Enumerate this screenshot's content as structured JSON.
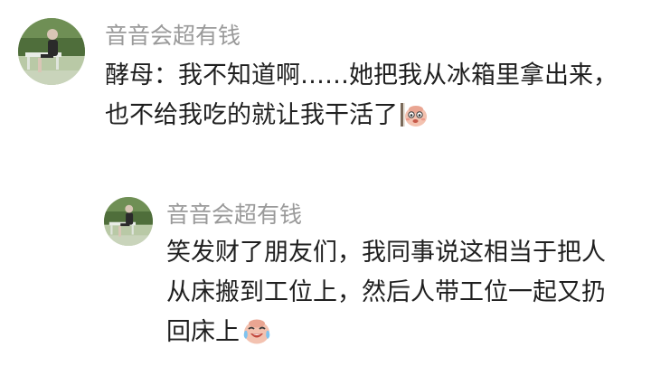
{
  "comments": [
    {
      "username": "音音会超有钱",
      "lines": [
        "酵母：我不知道啊……她把我从冰箱里拿出来，",
        "也不给我吃的就让我干活了"
      ],
      "emoji": "peeking-face-emoji"
    },
    {
      "username": "音音会超有钱",
      "lines": [
        "笑发财了朋友们，我同事说这相当于把人",
        "从床搬到工位上，然后人带工位一起又扔",
        "回床上"
      ],
      "emoji": "crying-laughing-face-emoji"
    }
  ],
  "colors": {
    "username": "#9a9a9a",
    "text": "#1f1f1f",
    "background": "#ffffff"
  }
}
